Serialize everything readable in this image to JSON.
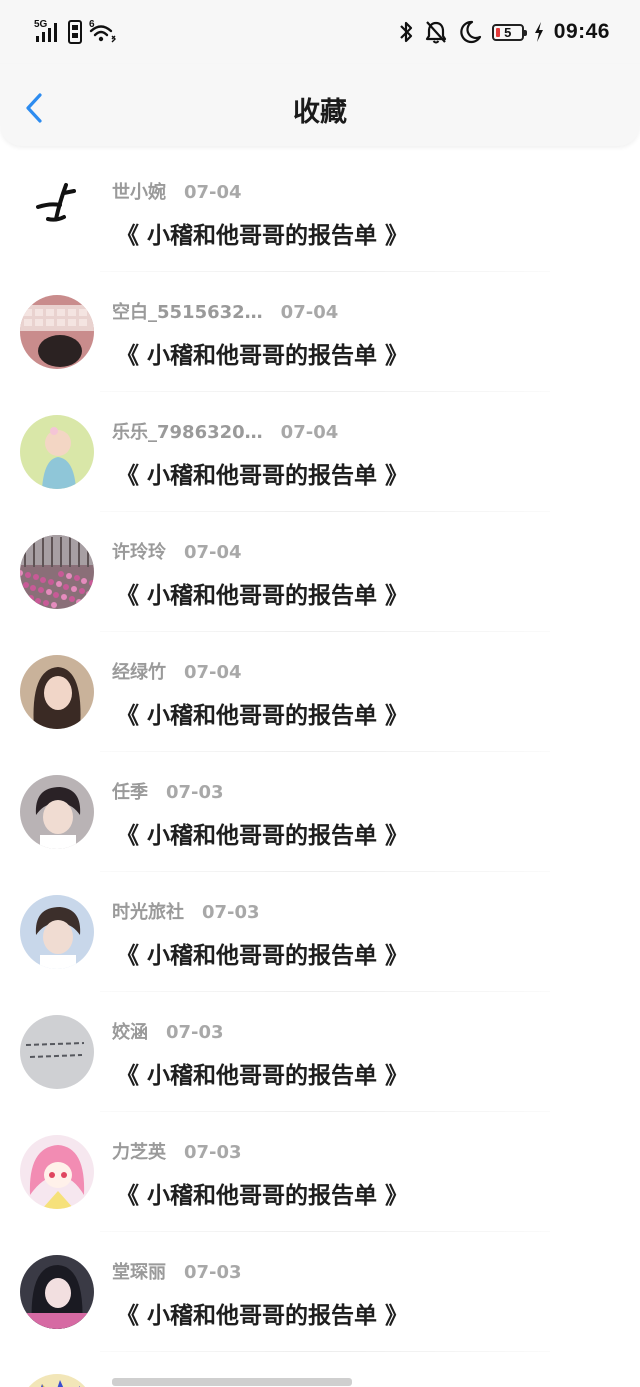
{
  "status_bar": {
    "network": "5G",
    "wifi_badge": "6",
    "battery_level": "5",
    "time": "09:46"
  },
  "header": {
    "title": "收藏"
  },
  "items": [
    {
      "user": "世小婉",
      "date": "07-04",
      "article": "《 小稽和他哥哥的报告单 》"
    },
    {
      "user": "空白_5515632…",
      "date": "07-04",
      "article": "《 小稽和他哥哥的报告单 》"
    },
    {
      "user": "乐乐_7986320…",
      "date": "07-04",
      "article": "《 小稽和他哥哥的报告单 》"
    },
    {
      "user": "许玲玲",
      "date": "07-04",
      "article": "《 小稽和他哥哥的报告单 》"
    },
    {
      "user": "经绿竹",
      "date": "07-04",
      "article": "《 小稽和他哥哥的报告单 》"
    },
    {
      "user": "任季",
      "date": "07-03",
      "article": "《 小稽和他哥哥的报告单 》"
    },
    {
      "user": "时光旅社",
      "date": "07-03",
      "article": "《 小稽和他哥哥的报告单 》"
    },
    {
      "user": "姣涵",
      "date": "07-03",
      "article": "《 小稽和他哥哥的报告单 》"
    },
    {
      "user": "力芝英",
      "date": "07-03",
      "article": "《 小稽和他哥哥的报告单 》"
    },
    {
      "user": "堂琛丽",
      "date": "07-03",
      "article": "《 小稽和他哥哥的报告单 》"
    }
  ],
  "colors": {
    "accent": "#2d8cf0",
    "text_primary": "#1e1e1e",
    "text_secondary": "#9a9a9a",
    "battery_low": "#e23b3b"
  },
  "avatars": [
    {
      "icon": "calligraphy-logo",
      "bg": "#ffffff",
      "fg": "#111111"
    },
    {
      "icon": "keyboard-photo",
      "bg": "#c98c8c",
      "fg": "#e9d2cf"
    },
    {
      "icon": "baby-photo",
      "bg": "#d9e7a8",
      "fg": "#8fc6d8"
    },
    {
      "icon": "flower-field-photo",
      "bg": "#8a6f78",
      "fg": "#c85a97"
    },
    {
      "icon": "girl-portrait-photo",
      "bg": "#c9b29a",
      "fg": "#3a2a24"
    },
    {
      "icon": "boy-portrait-photo",
      "bg": "#b9b3b5",
      "fg": "#2a2226"
    },
    {
      "icon": "boy-portrait-photo",
      "bg": "#c8d7ea",
      "fg": "#3c2f2b"
    },
    {
      "icon": "handwriting-photo",
      "bg": "#cfd0d3",
      "fg": "#56585e"
    },
    {
      "icon": "anime-girl-photo",
      "bg": "#f6e7ef",
      "fg": "#f28cb3"
    },
    {
      "icon": "girl-selfie-photo",
      "bg": "#3a3a45",
      "fg": "#d66aa3"
    }
  ]
}
